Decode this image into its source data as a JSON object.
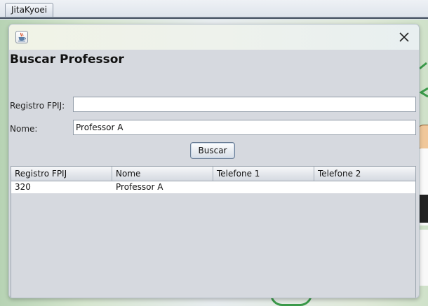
{
  "app": {
    "tab_label": "JitaKyoei"
  },
  "dialog": {
    "title_icon": "java-cup-icon",
    "close_icon": "close-icon"
  },
  "form": {
    "title": "Buscar Professor",
    "registro_label": "Registro FPIJ:",
    "registro_value": "",
    "nome_label": "Nome:",
    "nome_value": "Professor A",
    "search_button": "Buscar"
  },
  "table": {
    "columns": [
      "Registro FPIJ",
      "Nome",
      "Telefone 1",
      "Telefone 2"
    ],
    "rows": [
      [
        "320",
        "Professor A",
        "",
        ""
      ]
    ]
  },
  "colors": {
    "dialog_bg": "#d6d9df",
    "accent_green": "#3b9a4a"
  }
}
